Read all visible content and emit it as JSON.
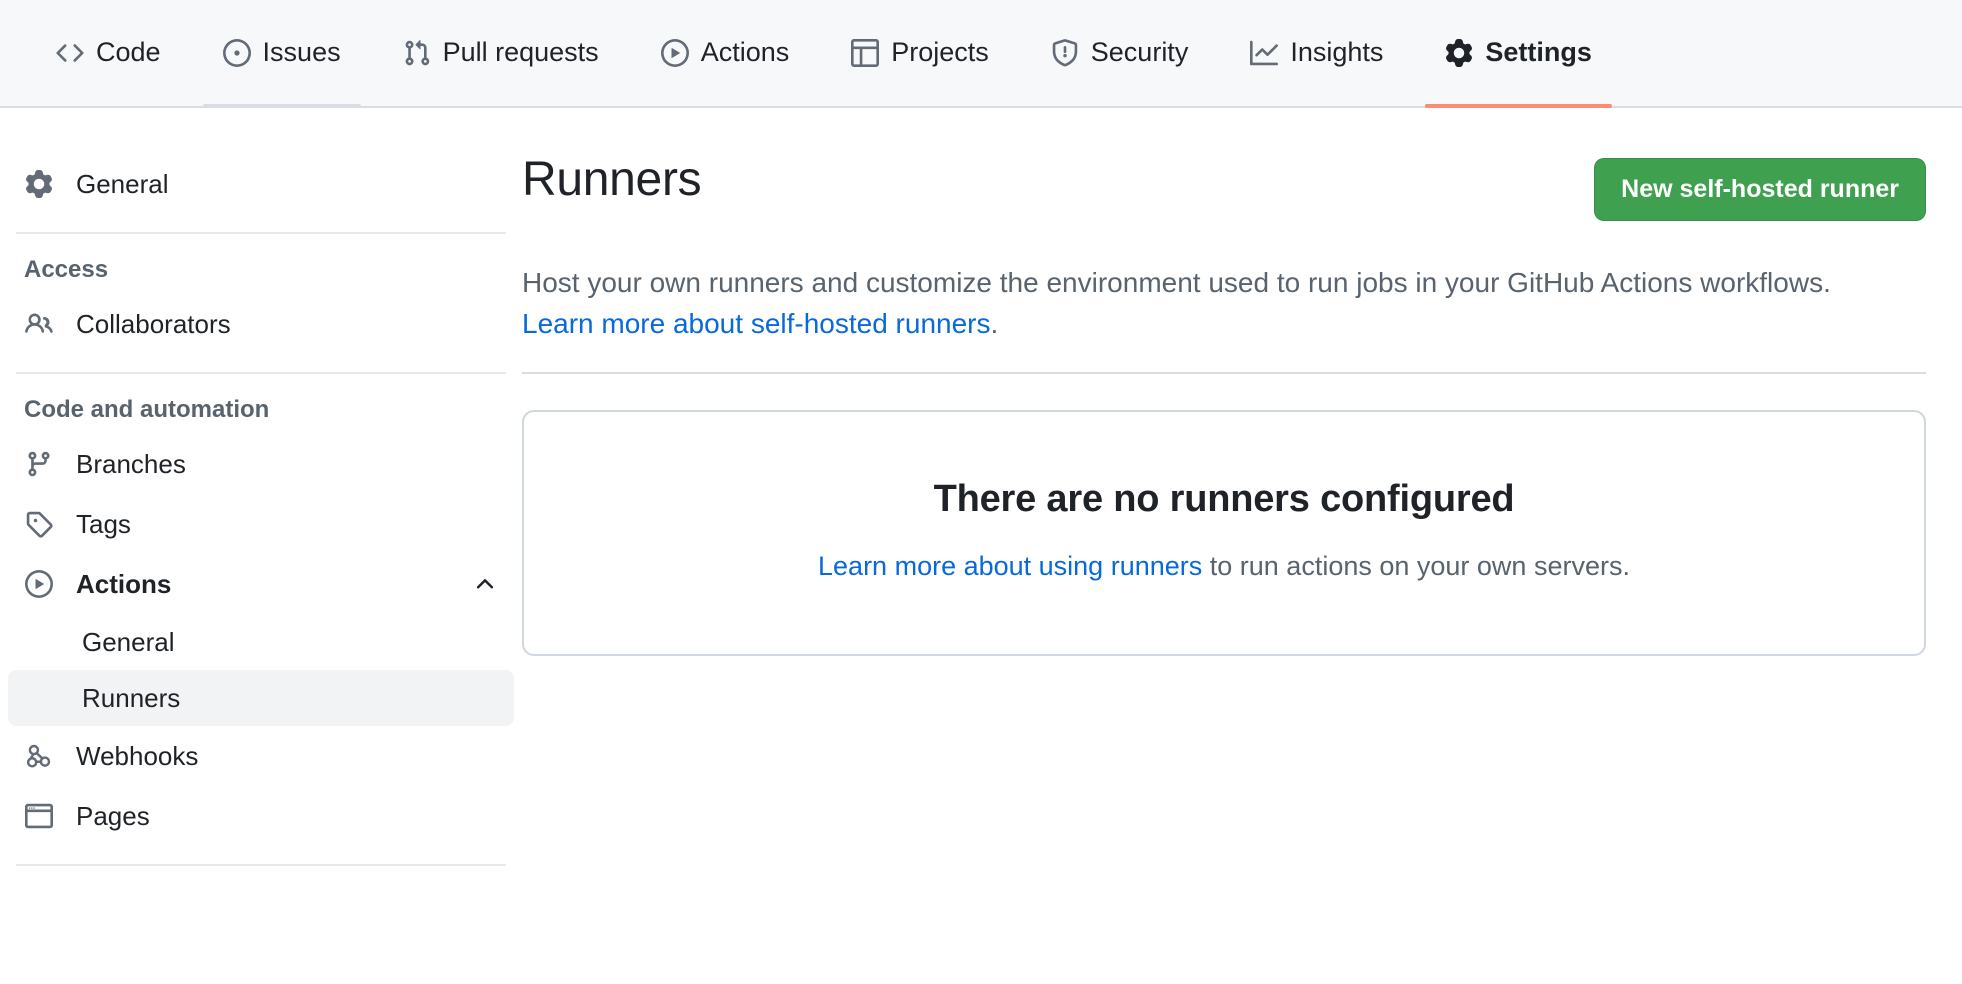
{
  "repo_nav": {
    "items": [
      {
        "label": "Code",
        "icon": "code-icon",
        "state": "default"
      },
      {
        "label": "Issues",
        "icon": "issue-opened-icon",
        "state": "hovered"
      },
      {
        "label": "Pull requests",
        "icon": "git-pull-request-icon",
        "state": "default"
      },
      {
        "label": "Actions",
        "icon": "play-icon",
        "state": "default"
      },
      {
        "label": "Projects",
        "icon": "table-icon",
        "state": "default"
      },
      {
        "label": "Security",
        "icon": "shield-exclamation-icon",
        "state": "default"
      },
      {
        "label": "Insights",
        "icon": "graph-icon",
        "state": "default"
      },
      {
        "label": "Settings",
        "icon": "gear-icon",
        "state": "selected"
      }
    ]
  },
  "sidebar": {
    "general_label": "General",
    "access_heading": "Access",
    "collaborators_label": "Collaborators",
    "code_automation_heading": "Code and automation",
    "branches_label": "Branches",
    "tags_label": "Tags",
    "actions_label": "Actions",
    "actions_general_label": "General",
    "actions_runners_label": "Runners",
    "webhooks_label": "Webhooks",
    "pages_label": "Pages"
  },
  "main": {
    "title": "Runners",
    "new_runner_button": "New self-hosted runner",
    "description_prefix": "Host your own runners and customize the environment used to run jobs in your GitHub Actions workflows. ",
    "description_link": "Learn more about self-hosted runners",
    "description_suffix": ".",
    "empty_title": "There are no runners configured",
    "empty_link": "Learn more about using runners",
    "empty_suffix": " to run actions on your own servers."
  },
  "colors": {
    "accent_blue": "#0969da",
    "selected_tab_underline": "#fd8c73",
    "primary_button_green": "#3fa050",
    "sidebar_selected_bar": "#2f6fd0",
    "nav_background": "#f6f8fa",
    "border": "#d0d7de"
  }
}
